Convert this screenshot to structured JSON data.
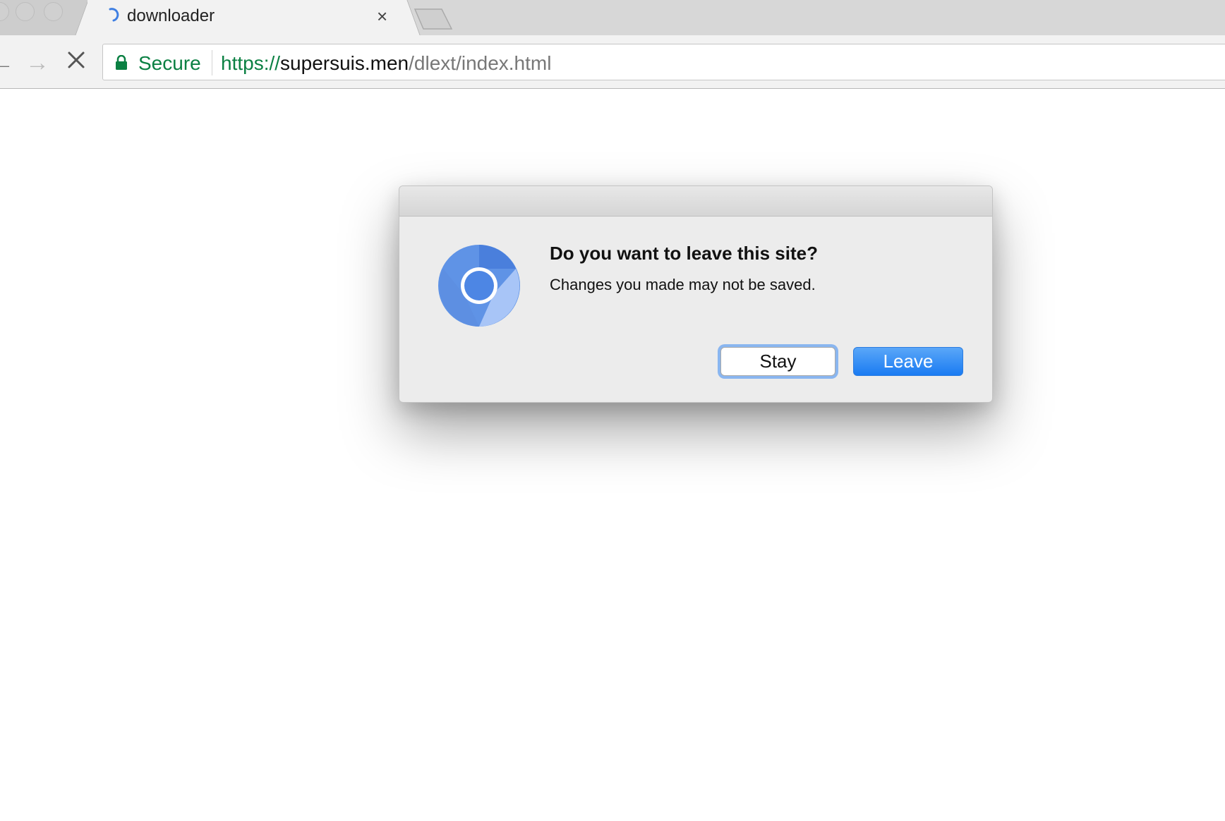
{
  "browser": {
    "tab": {
      "title": "downloader",
      "close_glyph": "×",
      "loading_icon": "spinner-icon"
    },
    "toolbar": {
      "back_glyph": "←",
      "forward_glyph": "→",
      "stop_icon": "close-icon"
    },
    "omnibox": {
      "secure_label": "Secure",
      "url_scheme": "https://",
      "url_host": "supersuis.men",
      "url_path": "/dlext/index.html",
      "secure_color": "#0b8043"
    }
  },
  "dialog": {
    "heading": "Do you want to leave this site?",
    "message": "Changes you made may not be saved.",
    "stay_label": "Stay",
    "leave_label": "Leave",
    "icon": "chrome-logo-icon",
    "accent_color": "#1a7bf2"
  }
}
